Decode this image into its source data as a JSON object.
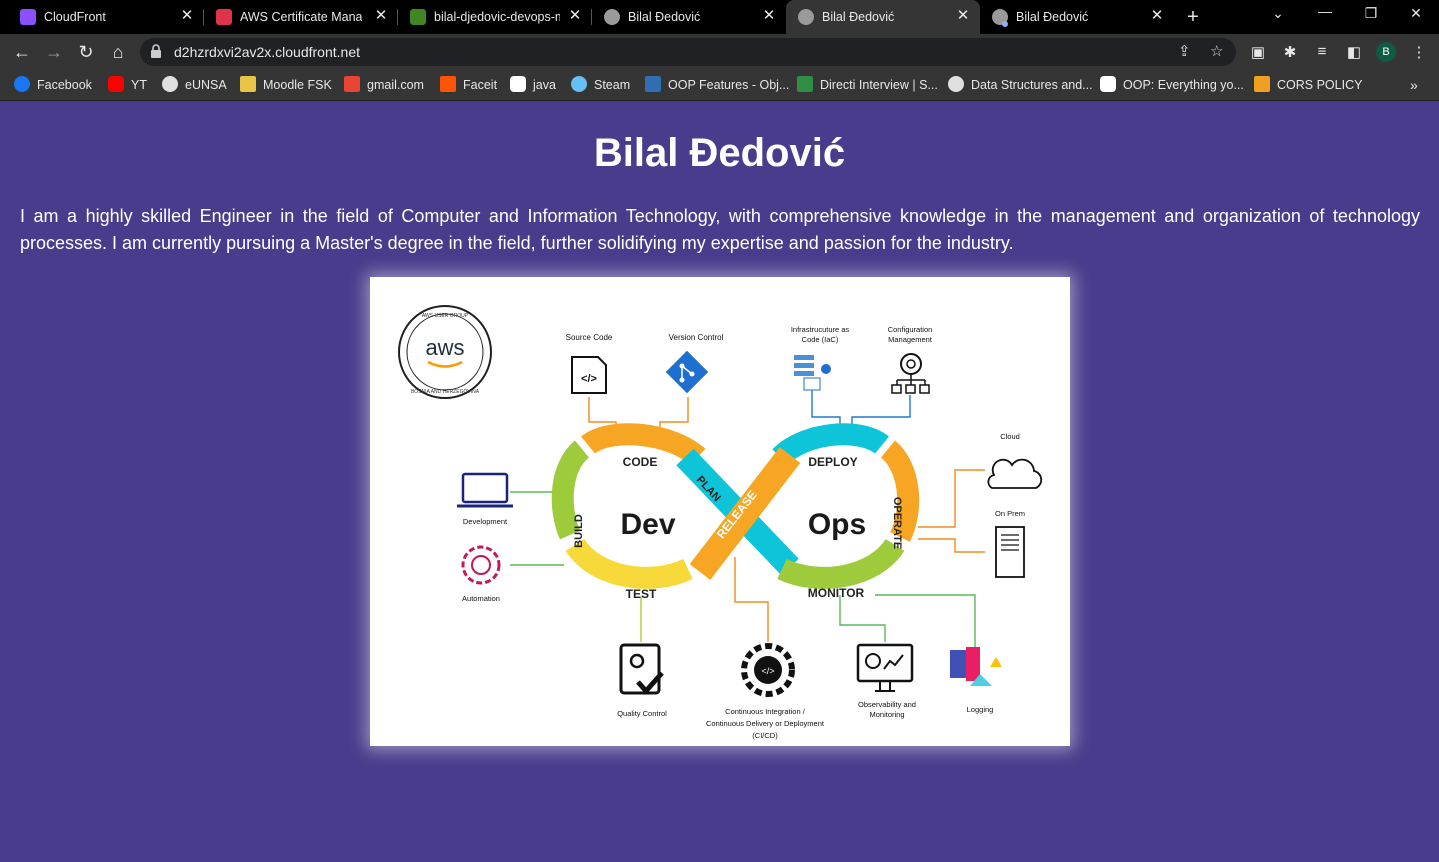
{
  "browser": {
    "tabs": [
      {
        "title": "CloudFront",
        "icon": "cloudfront-icon",
        "color": "#8c4fff"
      },
      {
        "title": "AWS Certificate Manage",
        "icon": "aws-cert-icon",
        "color": "#dd344c"
      },
      {
        "title": "bilal-djedovic-devops-m",
        "icon": "s3-bucket-icon",
        "color": "#3f8624"
      },
      {
        "title": "Bilal Đedović",
        "icon": "globe-icon"
      },
      {
        "title": "Bilal Đedović",
        "icon": "globe-icon"
      },
      {
        "title": "Bilal Đedović",
        "icon": "globe-icon"
      }
    ],
    "url": "d2hzrdxvi2av2x.cloudfront.net",
    "profile_initial": "B",
    "bookmarks": [
      {
        "label": "Facebook",
        "color": "#1877f2"
      },
      {
        "label": "YT",
        "color": "#ff0000"
      },
      {
        "label": "eUNSA",
        "color": "#e0e0e0"
      },
      {
        "label": "Moodle FSK",
        "color": "#e8c547"
      },
      {
        "label": "gmail.com",
        "color": "#ea4335"
      },
      {
        "label": "Faceit",
        "color": "#ff5500"
      },
      {
        "label": "java",
        "color": "#ffffff"
      },
      {
        "label": "Steam",
        "color": "#66c0f4"
      },
      {
        "label": "OOP Features - Obj...",
        "color": "#2f6fb0"
      },
      {
        "label": "Directi Interview | S...",
        "color": "#2f8d46"
      },
      {
        "label": "Data Structures and...",
        "color": "#e0e0e0"
      },
      {
        "label": "OOP: Everything yo...",
        "color": "#ffffff"
      },
      {
        "label": "CORS POLICY",
        "color": "#f0a020"
      }
    ]
  },
  "page": {
    "title": "Bilal Đedović",
    "intro": "I am a highly skilled Engineer in the field of Computer and Information Technology, with comprehensive knowledge in the management and organization of technology processes. I am currently pursuing a Master's degree in the field, further solidifying my expertise and passion for the industry."
  },
  "diagram": {
    "badge": "aws",
    "badge_ring": "AWS USER GROUP",
    "badge_ring2": "BOSNIA AND HERZEGOVINA",
    "dev": "Dev",
    "ops": "Ops",
    "segments": {
      "code": "CODE",
      "plan": "PLAN",
      "build": "BUILD",
      "test": "TEST",
      "release": "RELEASE",
      "deploy": "DEPLOY",
      "operate": "OPERATE",
      "monitor": "MONITOR"
    },
    "labels": {
      "source_code": "Source Code",
      "version_control": "Version Control",
      "iac1": "Infrastrucuture as",
      "iac2": "Code (IaC)",
      "config1": "Configuration",
      "config2": "Management",
      "cloud": "Cloud",
      "on_prem": "On Prem",
      "development": "Development",
      "automation": "Automation",
      "quality": "Quality Control",
      "cicd1": "Continuous Integration /",
      "cicd2": "Continuous Delivery or Deployment",
      "cicd3": "(CI/CD)",
      "obs1": "Observability and",
      "obs2": "Monitoring",
      "logging": "Logging"
    }
  }
}
